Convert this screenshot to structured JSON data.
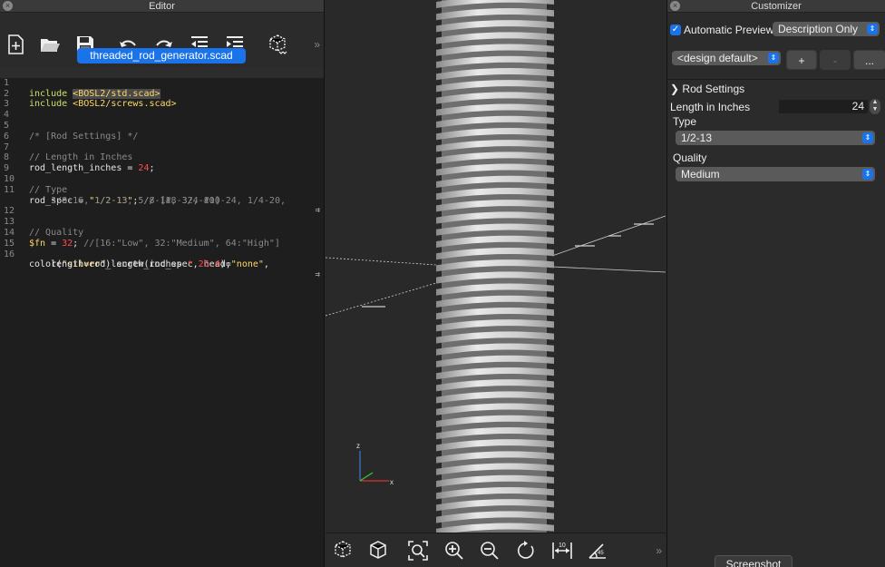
{
  "editor": {
    "title": "Editor",
    "file_tab": "threaded_rod_generator.scad",
    "lines": [
      {
        "n": "1"
      },
      {
        "n": "2"
      },
      {
        "n": "3"
      },
      {
        "n": "4"
      },
      {
        "n": "5"
      },
      {
        "n": "6"
      },
      {
        "n": "7"
      },
      {
        "n": "8"
      },
      {
        "n": "9"
      },
      {
        "n": "10"
      },
      {
        "n": "11"
      },
      {
        "n": "12"
      },
      {
        "n": "13"
      },
      {
        "n": "14"
      },
      {
        "n": "15"
      },
      {
        "n": "16"
      }
    ],
    "code": {
      "l1_kw": "include ",
      "l1_path": "<BOSL2/std.scad>",
      "l2_kw": "include ",
      "l2_path": "<BOSL2/screws.scad>",
      "l5": "/* [Rod Settings] */",
      "l7": "// Length in Inches",
      "l8_a": "rod_length_inches = ",
      "l8_num": "24",
      "l8_b": ";",
      "l10": "// Type",
      "l11_a": "rod_spec = ",
      "l11_str": "\"1/2-13\"",
      "l11_b": "; ",
      "l11_com": "// [#8-32, #10-24, 1/4-20,",
      "l11_cont": "    3/8-16, 1/2-13, 5/8-11, 3/4-10]",
      "l13": "// Quality",
      "l14_var": "$fn",
      "l14_a": " = ",
      "l14_num": "32",
      "l14_b": "; ",
      "l14_com": "//[16:\"Low\", 32:\"Medium\", 64:\"High\"]",
      "l16_a": "color(",
      "l16_str1": "\"silver\"",
      "l16_b": ") screw(rod_spec, head=",
      "l16_str2": "\"none\"",
      "l16_c": ",",
      "l16_cont_a": "    length=rod_length_inches ",
      "l16_cont_op": "*",
      "l16_cont_sp": " ",
      "l16_cont_num": "25.4",
      "l16_cont_b": ");",
      "wrap_mark": "⇉"
    },
    "toolbar_more": "»"
  },
  "viewport": {
    "axis_z": "z",
    "axis_x": "x",
    "more": "»"
  },
  "customizer": {
    "title": "Customizer",
    "auto_preview_label": "Automatic Preview",
    "description_select": "Description Only",
    "preset_select": "<design default>",
    "add_btn": "+",
    "remove_btn": "-",
    "more_btn": "...",
    "section": "Rod Settings",
    "length_label": "Length in Inches",
    "length_value": "24",
    "type_label": "Type",
    "type_value": "1/2-13",
    "quality_label": "Quality",
    "quality_value": "Medium",
    "screenshot_btn": "Screenshot"
  },
  "colors": {
    "accent": "#1a73e8",
    "keyword": "#c8e06b",
    "string": "#ffd866",
    "number": "#ff4d4d",
    "comment": "#8a8a8a"
  }
}
